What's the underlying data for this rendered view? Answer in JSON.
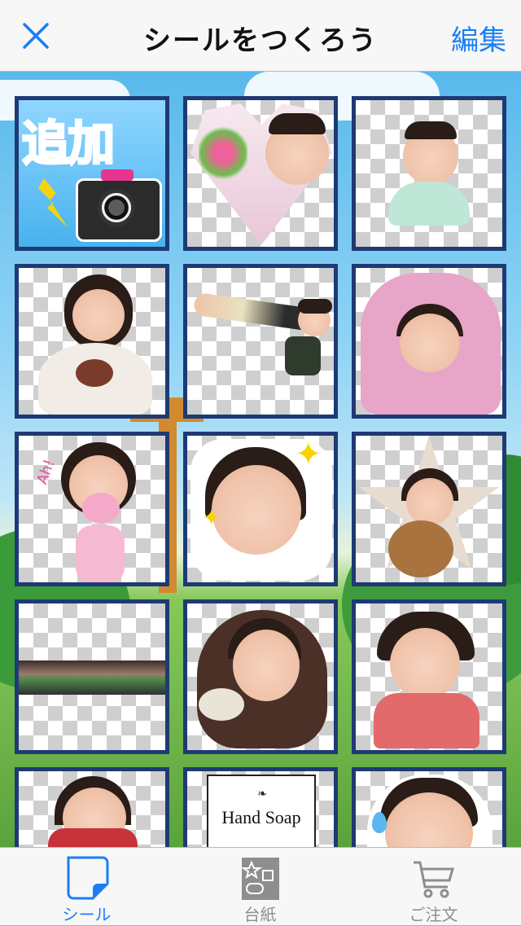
{
  "nav": {
    "title": "シールをつくろう",
    "edit_label": "編集"
  },
  "grid": {
    "add_tile_text": "追加",
    "tiles": [
      {
        "kind": "add"
      },
      {
        "kind": "sticker",
        "shape": "heart"
      },
      {
        "kind": "sticker",
        "shape": "cutout"
      },
      {
        "kind": "sticker",
        "shape": "cutout"
      },
      {
        "kind": "sticker",
        "shape": "cutout"
      },
      {
        "kind": "sticker",
        "shape": "cutout"
      },
      {
        "kind": "sticker",
        "shape": "cutout",
        "text": "Ah!"
      },
      {
        "kind": "sticker",
        "shape": "cutout"
      },
      {
        "kind": "sticker",
        "shape": "star"
      },
      {
        "kind": "sticker",
        "shape": "strip"
      },
      {
        "kind": "sticker",
        "shape": "cloud"
      },
      {
        "kind": "sticker",
        "shape": "cutout"
      },
      {
        "kind": "sticker",
        "shape": "cutout"
      },
      {
        "kind": "sticker",
        "shape": "card",
        "text": "Hand Soap"
      },
      {
        "kind": "sticker",
        "shape": "cutout"
      }
    ]
  },
  "tabs": [
    {
      "label": "シール",
      "icon": "sticker-icon",
      "active": true
    },
    {
      "label": "台紙",
      "icon": "sheet-icon",
      "active": false
    },
    {
      "label": "ご注文",
      "icon": "cart-icon",
      "active": false
    }
  ],
  "colors": {
    "accent": "#1a7ff5",
    "tile_border": "#1e3a74"
  }
}
